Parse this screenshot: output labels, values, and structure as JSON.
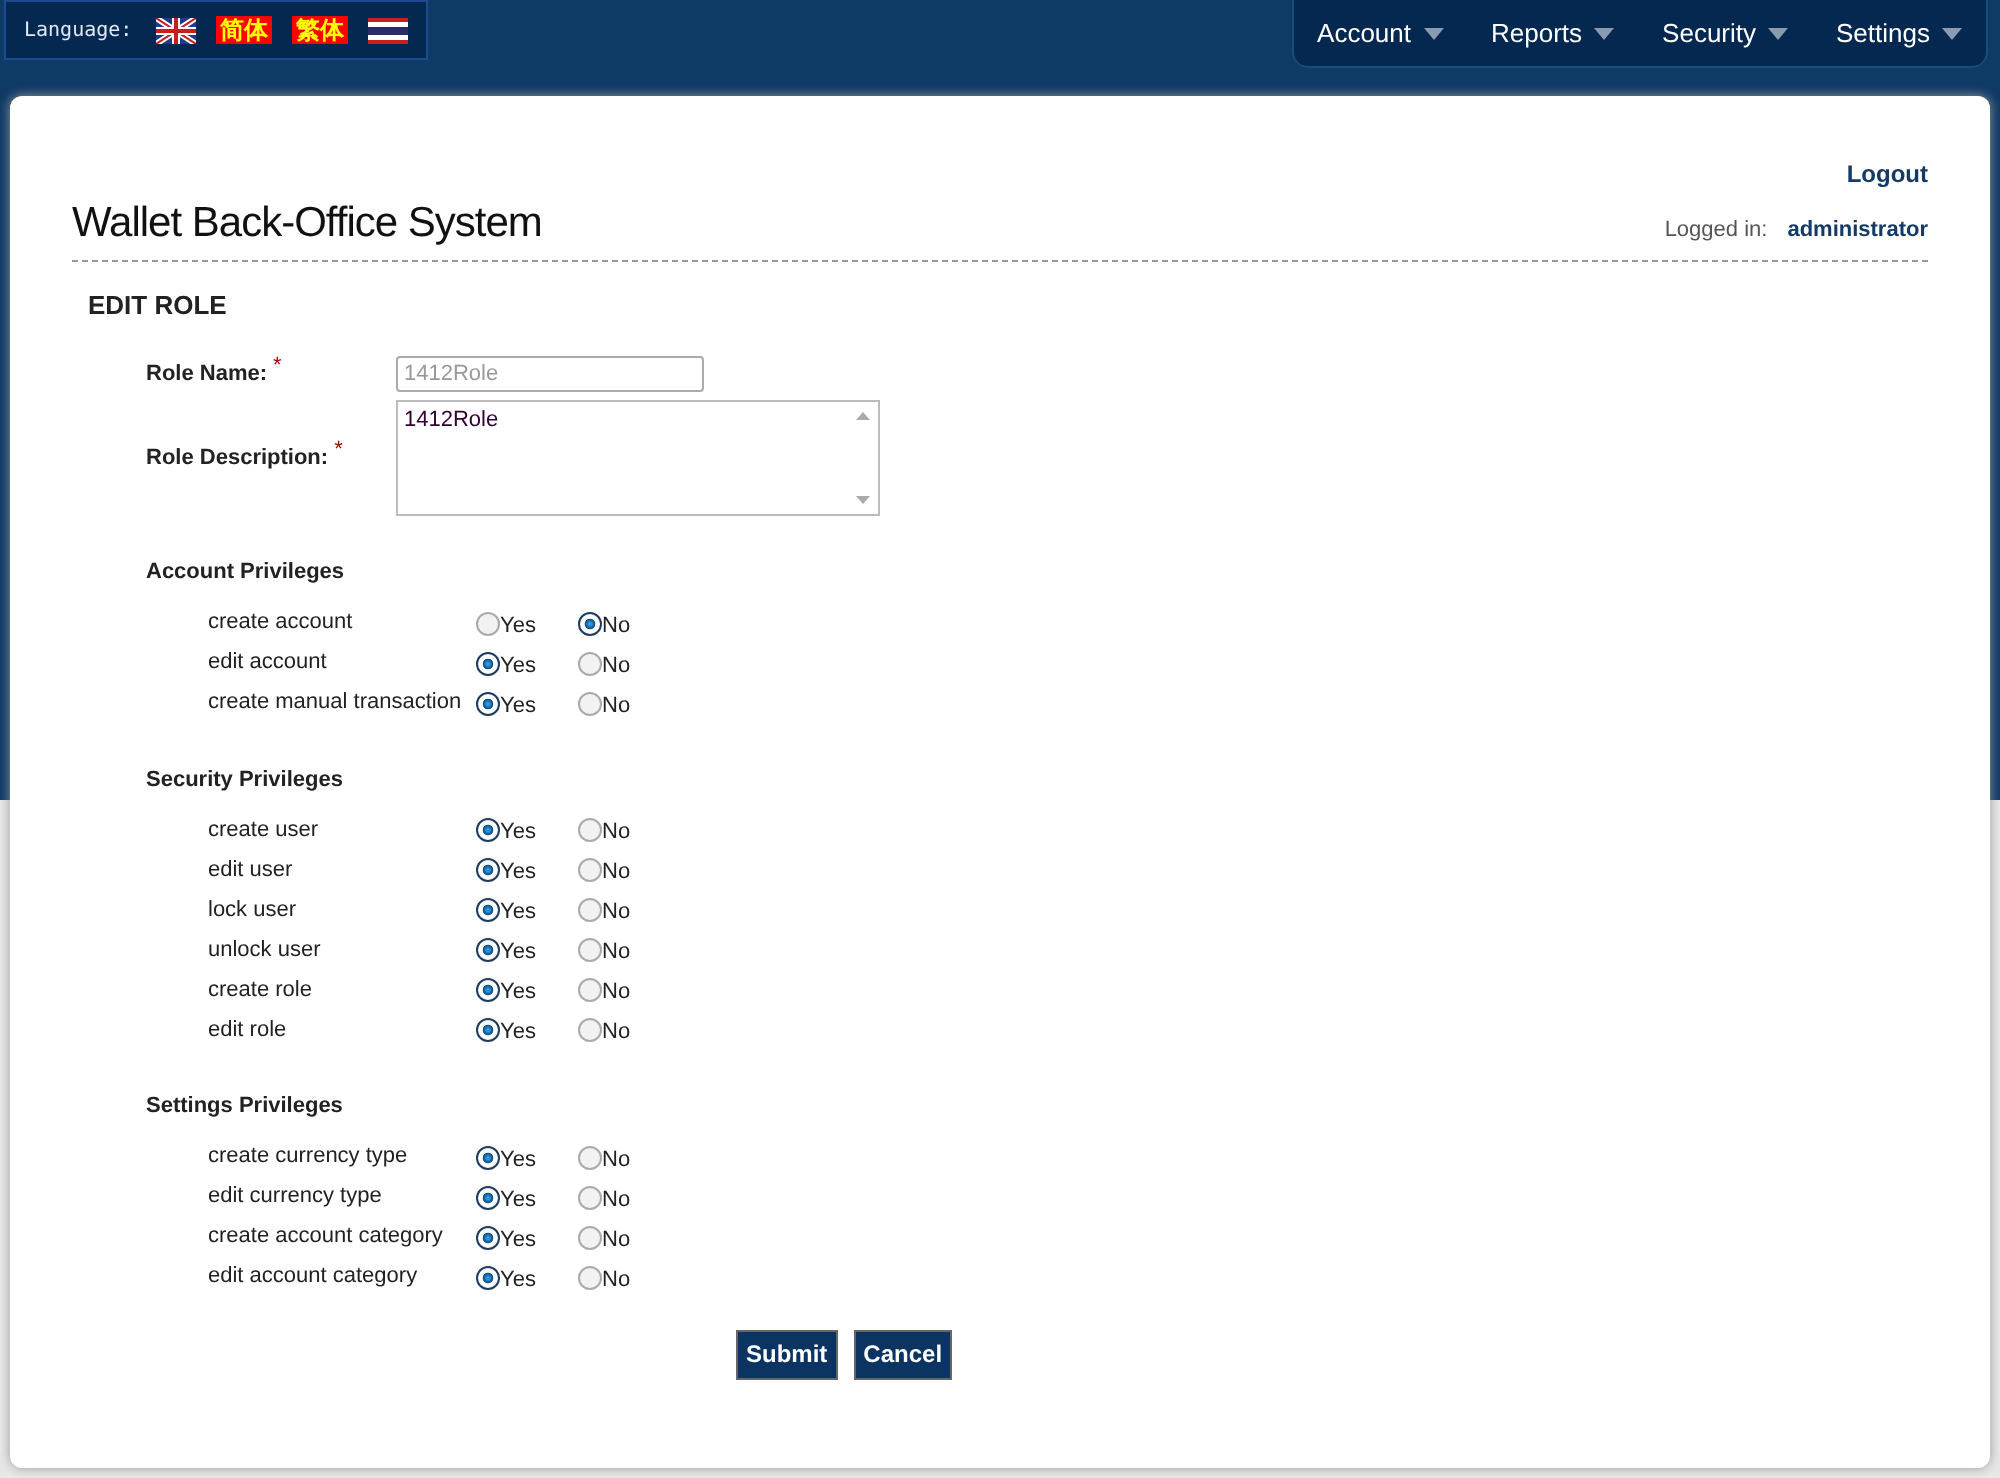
{
  "language_bar": {
    "label": "Language:",
    "options": [
      {
        "kind": "uk-flag"
      },
      {
        "kind": "text",
        "label": "简体"
      },
      {
        "kind": "text",
        "label": "繁体"
      },
      {
        "kind": "thai-flag"
      }
    ]
  },
  "nav": [
    {
      "label": "Account"
    },
    {
      "label": "Reports"
    },
    {
      "label": "Security"
    },
    {
      "label": "Settings"
    }
  ],
  "header": {
    "title": "Wallet Back-Office System",
    "logout": "Logout",
    "logged_in_label": "Logged in:",
    "user": "administrator"
  },
  "form": {
    "heading": "EDIT ROLE",
    "required_mark": "*",
    "role_name": {
      "label": "Role Name:",
      "value": "1412Role"
    },
    "role_description": {
      "label": "Role Description:",
      "value": "1412Role"
    },
    "sections": [
      {
        "title": "Account Privileges",
        "items": [
          {
            "name": "create account",
            "options": [
              {
                "label": "Yes",
                "selected": false
              },
              {
                "label": "No",
                "selected": true
              }
            ]
          },
          {
            "name": "edit account",
            "options": [
              {
                "label": "Yes",
                "selected": true
              },
              {
                "label": "No",
                "selected": false
              }
            ]
          },
          {
            "name": "create manual transaction",
            "options": [
              {
                "label": "Yes",
                "selected": true
              },
              {
                "label": "No",
                "selected": false
              }
            ]
          }
        ]
      },
      {
        "title": "Security Privileges",
        "items": [
          {
            "name": "create user",
            "options": [
              {
                "label": "Yes",
                "selected": true
              },
              {
                "label": "No",
                "selected": false
              }
            ]
          },
          {
            "name": "edit user",
            "options": [
              {
                "label": "Yes",
                "selected": true
              },
              {
                "label": "No",
                "selected": false
              }
            ]
          },
          {
            "name": "lock user",
            "options": [
              {
                "label": "Yes",
                "selected": true
              },
              {
                "label": "No",
                "selected": false
              }
            ]
          },
          {
            "name": "unlock user",
            "options": [
              {
                "label": "Yes",
                "selected": true
              },
              {
                "label": "No",
                "selected": false
              }
            ]
          },
          {
            "name": "create role",
            "options": [
              {
                "label": "Yes",
                "selected": true
              },
              {
                "label": "No",
                "selected": false
              }
            ]
          },
          {
            "name": "edit role",
            "options": [
              {
                "label": "Yes",
                "selected": true
              },
              {
                "label": "No",
                "selected": false
              }
            ]
          }
        ]
      },
      {
        "title": "Settings Privileges",
        "items": [
          {
            "name": "create currency type",
            "options": [
              {
                "label": "Yes",
                "selected": true
              },
              {
                "label": "No",
                "selected": false
              }
            ]
          },
          {
            "name": "edit currency type",
            "options": [
              {
                "label": "Yes",
                "selected": true
              },
              {
                "label": "No",
                "selected": false
              }
            ]
          },
          {
            "name": "create account category",
            "options": [
              {
                "label": "Yes",
                "selected": true
              },
              {
                "label": "No",
                "selected": false
              }
            ]
          },
          {
            "name": "edit account category",
            "options": [
              {
                "label": "Yes",
                "selected": true
              },
              {
                "label": "No",
                "selected": false
              }
            ]
          }
        ]
      }
    ],
    "buttons": [
      "Submit",
      "Cancel"
    ]
  }
}
